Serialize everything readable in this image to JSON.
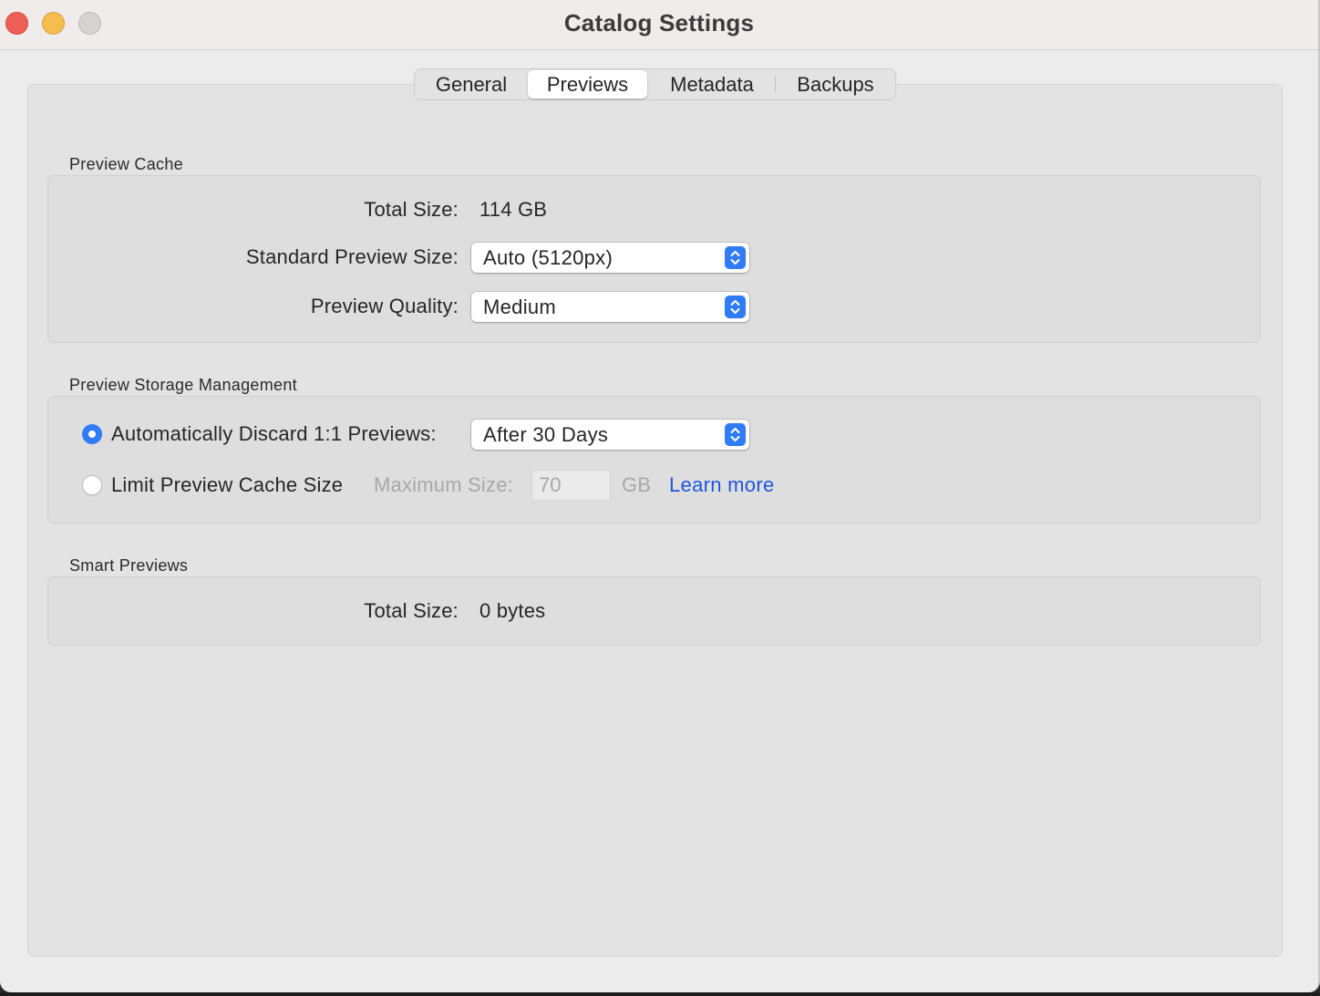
{
  "window": {
    "title": "Catalog Settings"
  },
  "tabs": [
    {
      "label": "General",
      "selected": false
    },
    {
      "label": "Previews",
      "selected": true
    },
    {
      "label": "Metadata",
      "selected": false
    },
    {
      "label": "Backups",
      "selected": false
    }
  ],
  "preview_cache": {
    "group_label": "Preview Cache",
    "total_size_label": "Total Size:",
    "total_size_value": "114 GB",
    "standard_preview_label": "Standard Preview Size:",
    "standard_preview_value": "Auto (5120px)",
    "quality_label": "Preview Quality:",
    "quality_value": "Medium"
  },
  "storage": {
    "group_label": "Preview Storage Management",
    "discard_label": "Automatically Discard 1:1 Previews:",
    "discard_selected": true,
    "discard_value": "After 30 Days",
    "limit_label": "Limit Preview Cache Size",
    "limit_selected": false,
    "max_size_label": "Maximum Size:",
    "max_size_value": "70",
    "max_size_unit": "GB",
    "learn_more": "Learn more"
  },
  "smart_previews": {
    "group_label": "Smart Previews",
    "total_size_label": "Total Size:",
    "total_size_value": "0 bytes"
  },
  "colors": {
    "accent": "#2f7cf6",
    "link": "#1f56e0",
    "close": "#ee5f57",
    "minimize": "#f5bd4f",
    "zoom_inactive": "#d6d3d3"
  }
}
